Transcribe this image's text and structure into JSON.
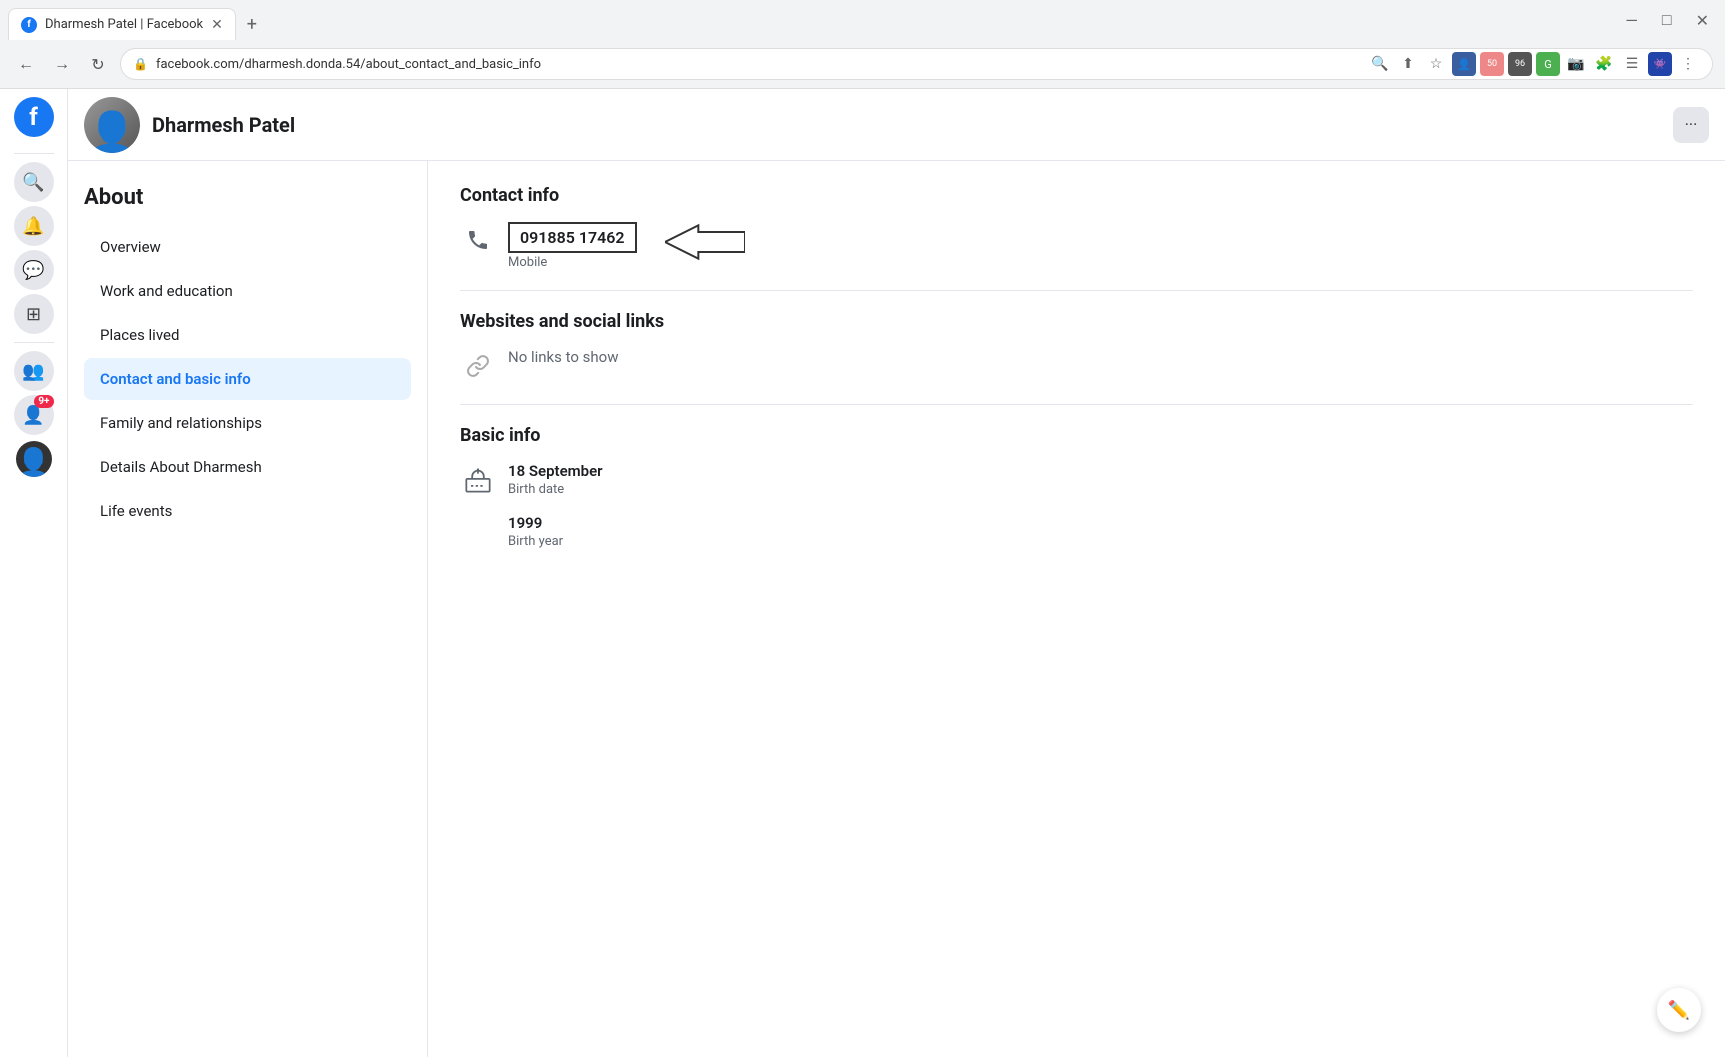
{
  "browser": {
    "tab_title": "Dharmesh Patel | Facebook",
    "url": "facebook.com/dharmesh.donda.54/about_contact_and_basic_info",
    "new_tab_label": "+"
  },
  "header": {
    "profile_name": "Dharmesh Patel",
    "more_button_label": "···"
  },
  "facebook_logo": "f",
  "sidebar_icons": {
    "search": "🔍",
    "bell": "🔔",
    "messenger": "💬",
    "grid": "⊞",
    "people": "👥",
    "notifications_badge": "9+"
  },
  "about_nav": {
    "title": "About",
    "items": [
      {
        "id": "overview",
        "label": "Overview",
        "active": false
      },
      {
        "id": "work",
        "label": "Work and education",
        "active": false
      },
      {
        "id": "places",
        "label": "Places lived",
        "active": false
      },
      {
        "id": "contact",
        "label": "Contact and basic info",
        "active": true
      },
      {
        "id": "family",
        "label": "Family and relationships",
        "active": false
      },
      {
        "id": "details",
        "label": "Details About Dharmesh",
        "active": false
      },
      {
        "id": "life",
        "label": "Life events",
        "active": false
      }
    ]
  },
  "contact_info": {
    "section_title": "Contact info",
    "phone": {
      "number": "091885 17462",
      "label": "Mobile"
    }
  },
  "social_links": {
    "section_title": "Websites and social links",
    "no_links_text": "No links to show"
  },
  "basic_info": {
    "section_title": "Basic info",
    "birth_date": "18 September",
    "birth_date_label": "Birth date",
    "birth_year": "1999",
    "birth_year_label": "Birth year"
  }
}
